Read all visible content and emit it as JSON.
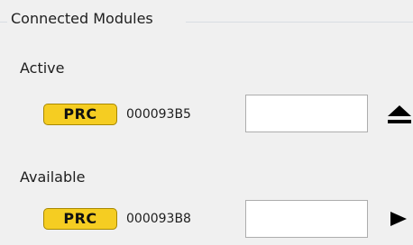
{
  "group": {
    "title": "Connected Modules"
  },
  "active": {
    "label": "Active",
    "module": {
      "type": "PRC",
      "serial": "000093B5",
      "slot_value": "",
      "action_icon": "eject-icon"
    }
  },
  "available": {
    "label": "Available",
    "module": {
      "type": "PRC",
      "serial": "000093B8",
      "slot_value": "",
      "action_icon": "play-icon"
    }
  },
  "colors": {
    "badge_fill": "#f5cd22",
    "badge_border": "#a88800",
    "background": "#f0f0f0"
  }
}
